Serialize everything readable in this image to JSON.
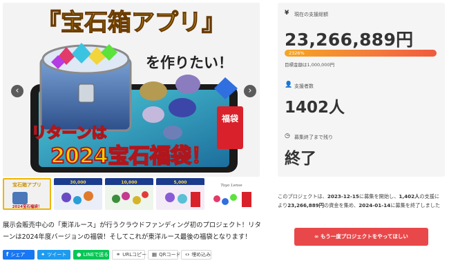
{
  "hero": {
    "title_line": "『宝石箱アプリ』",
    "sub_line": "を作りたい！",
    "return_line": "リターンは",
    "main_line": "2024宝石福袋！",
    "fukubukuro": "福袋"
  },
  "thumbnails": [
    {
      "label": "宝石箱アプリ",
      "sub": "2024宝石福袋！"
    },
    {
      "label": "30,000"
    },
    {
      "label": "10,000"
    },
    {
      "label": "5,000"
    },
    {
      "label": "Toyo Lense"
    }
  ],
  "description": "展示会販売中心の「東洋ルース」が行うクラウドファンディング初のプロジェクト！リターンは2024年度バージョンの福袋！そしてこれが東洋ルース最後の福袋となります！",
  "share": {
    "facebook": "シェア",
    "twitter": "ツイート",
    "line": "LINEで送る",
    "url_copy": "URLコピー",
    "qr": "QRコード",
    "embed": "埋め込み"
  },
  "stats": {
    "total_label": "現在の支援総額",
    "total_amount": "23,266,889円",
    "progress_percent_text": "2326%",
    "progress_percent": 2326,
    "goal": "目標金額は1,000,000円",
    "supporters_label": "支援者数",
    "supporters": "1402人",
    "remaining_label": "募集終了まで残り",
    "remaining": "終了"
  },
  "summary": {
    "p1": "このプロジェクトは、",
    "start": "2023-12-15",
    "p2": "に募集を開始し、",
    "count": "1,402人",
    "p3": "の支援により",
    "amount": "23,266,889円",
    "p4": "の資金を集め、",
    "end": "2024-01-14",
    "p5": "に募集を終了しました"
  },
  "cta_label": "もう一度プロジェクトをやってほしい",
  "colors": {
    "accent_red": "#e9484a",
    "progress_start": "#f5a623",
    "progress_end": "#f05a3e",
    "panel_bg": "#f5f5f5"
  }
}
